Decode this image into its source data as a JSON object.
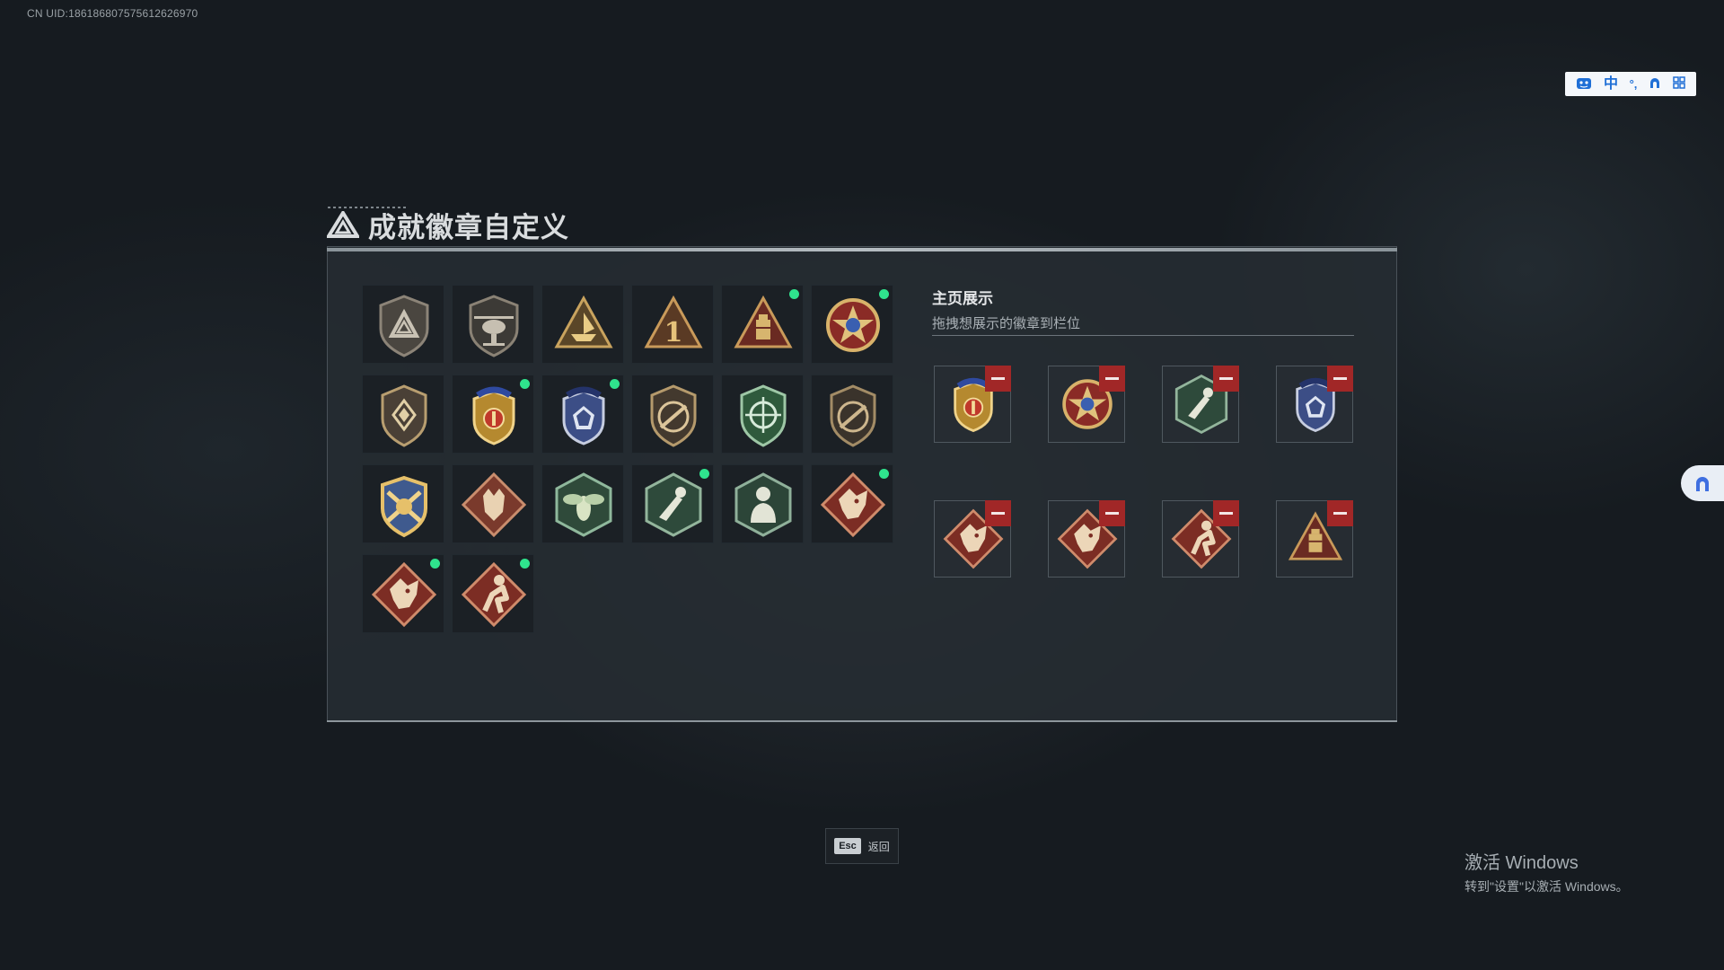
{
  "uid_text": "CN UID:186186807575612626970",
  "ime_bar": {
    "mode_label": "中",
    "punct_label": "°,"
  },
  "page_title": "成就徽章自定义",
  "showcase": {
    "title": "主页展示",
    "subtitle": "拖拽想展示的徽章到栏位"
  },
  "badges": [
    {
      "icon": "shield-triangle-badge",
      "new": false
    },
    {
      "icon": "helicopter-badge",
      "new": false
    },
    {
      "icon": "boat-triangle-badge",
      "new": false
    },
    {
      "icon": "number-one-triangle-badge",
      "new": false
    },
    {
      "icon": "crate-triangle-badge",
      "new": true
    },
    {
      "icon": "star-medal-badge",
      "new": true
    },
    {
      "icon": "diamond-shield-badge",
      "new": false
    },
    {
      "icon": "gold-crest-badge",
      "new": true
    },
    {
      "icon": "blue-crest-badge",
      "new": true
    },
    {
      "icon": "rifle-shield-badge",
      "new": false
    },
    {
      "icon": "crosshair-green-badge",
      "new": false
    },
    {
      "icon": "rifle-shield-dark-badge",
      "new": false
    },
    {
      "icon": "crossed-rifles-gold-badge",
      "new": false
    },
    {
      "icon": "wolf-diamond-badge",
      "new": false
    },
    {
      "icon": "wasp-hexagon-badge",
      "new": false
    },
    {
      "icon": "soldier-hexagon-badge",
      "new": true
    },
    {
      "icon": "operator-hexagon-badge",
      "new": false
    },
    {
      "icon": "dragon-diamond-badge",
      "new": true
    },
    {
      "icon": "dragon-diamond-badge",
      "new": true
    },
    {
      "icon": "runner-diamond-badge",
      "new": true
    }
  ],
  "slots": [
    {
      "icon": "gold-crest-badge"
    },
    {
      "icon": "star-medal-badge"
    },
    {
      "icon": "soldier-hexagon-badge"
    },
    {
      "icon": "blue-crest-badge"
    },
    {
      "icon": "dragon-diamond-badge"
    },
    {
      "icon": "dragon-diamond-badge"
    },
    {
      "icon": "runner-diamond-badge"
    },
    {
      "icon": "crate-triangle-badge"
    }
  ],
  "esc": {
    "key": "Esc",
    "label": "返回"
  },
  "windows_activation": {
    "line1": "激活 Windows",
    "line2": "转到\"设置\"以激活 Windows。"
  },
  "colors": {
    "new_dot": "#2fe38d",
    "remove_button": "#a12727",
    "panel_bg": "#262c32"
  }
}
